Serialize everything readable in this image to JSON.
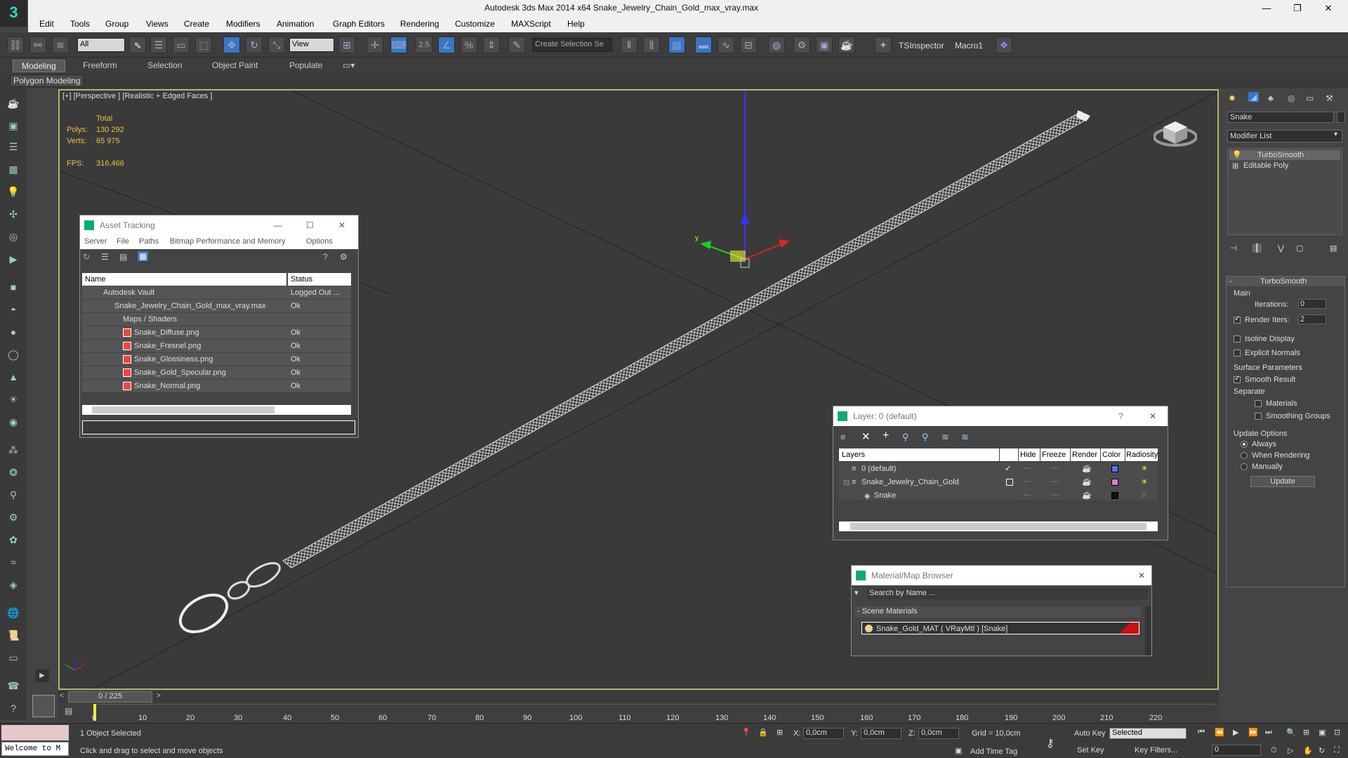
{
  "window": {
    "title": "Autodesk 3ds Max  2014 x64     Snake_Jewelry_Chain_Gold_max_vray.max",
    "minimize": "—",
    "restore": "❐",
    "close": "✕"
  },
  "menu": [
    "Edit",
    "Tools",
    "Group",
    "Views",
    "Create",
    "Modifiers",
    "Animation",
    "Graph Editors",
    "Rendering",
    "Customize",
    "MAXScript",
    "Help"
  ],
  "toolbar": {
    "selection_filter": "All",
    "ref_coord": "View",
    "snap_label": "2.5",
    "named_selection_placeholder": "Create Selection Se",
    "tsinspector": "TSInspector",
    "macro1": "Macro1"
  },
  "ribbon": {
    "tabs": [
      "Modeling",
      "Freeform",
      "Selection",
      "Object Paint",
      "Populate"
    ],
    "sub": "Polygon Modeling"
  },
  "viewport": {
    "label": "[+] [Perspective ] [Realistic + Edged Faces ]",
    "stats": {
      "total": "Total",
      "polys_label": "Polys:",
      "polys": "130 292",
      "verts_label": "Verts:",
      "verts": "65 975",
      "fps_label": "FPS:",
      "fps": "316,466"
    },
    "gizmo": {
      "x": "x",
      "y": "y",
      "z": "z"
    }
  },
  "asset_tracking": {
    "title": "Asset Tracking",
    "menu": [
      "Server",
      "File",
      "Paths",
      "Bitmap Performance and Memory",
      "Options"
    ],
    "columns": [
      "Name",
      "Status"
    ],
    "rows": [
      {
        "name": "Autodesk Vault",
        "status": "Logged Out ..."
      },
      {
        "name": "Snake_Jewelry_Chain_Gold_max_vray.max",
        "status": "Ok"
      },
      {
        "name": "Maps / Shaders",
        "status": ""
      },
      {
        "name": "Snake_Diffuse.png",
        "status": "Ok"
      },
      {
        "name": "Snake_Fresnel.png",
        "status": "Ok"
      },
      {
        "name": "Snake_Glossiness.png",
        "status": "Ok"
      },
      {
        "name": "Snake_Gold_Specular.png",
        "status": "Ok"
      },
      {
        "name": "Snake_Normal.png",
        "status": "Ok"
      }
    ]
  },
  "layer_window": {
    "title": "Layer: 0 (default)",
    "help": "?",
    "columns": [
      "Layers",
      "Hide",
      "Freeze",
      "Render",
      "Color",
      "Radiosity"
    ],
    "rows": [
      {
        "name": "0 (default)",
        "color": "#5577ff"
      },
      {
        "name": "Snake_Jewelry_Chain_Gold",
        "color": "#e07bd8"
      },
      {
        "name": "Snake",
        "color": "#111111"
      }
    ]
  },
  "material_browser": {
    "title": "Material/Map Browser",
    "search_placeholder": "Search by Name ...",
    "section": "- Scene Materials",
    "material": "Snake_Gold_MAT ( VRayMtl ) [Snake]"
  },
  "command_panel": {
    "object_name": "Snake",
    "modifier_list": "Modifier List",
    "stack": [
      "TurboSmooth",
      "Editable Poly"
    ],
    "rollout_title": "TurboSmooth",
    "main": "Main",
    "iterations_label": "Iterations:",
    "iterations": "0",
    "render_iters_label": "Render Iters:",
    "render_iters": "2",
    "isoline": "Isoline Display",
    "explicit_normals": "Explicit Normals",
    "surface_params": "Surface Parameters",
    "smooth_result": "Smooth Result",
    "separate": "Separate",
    "materials": "Materials",
    "smoothing_groups": "Smoothing Groups",
    "update_options": "Update Options",
    "always": "Always",
    "when_rendering": "When Rendering",
    "manually": "Manually",
    "update": "Update"
  },
  "timeline": {
    "frame": "0 / 225",
    "ticks": [
      "0",
      "10",
      "20",
      "30",
      "40",
      "50",
      "60",
      "70",
      "80",
      "90",
      "100",
      "110",
      "120",
      "130",
      "140",
      "150",
      "160",
      "170",
      "180",
      "190",
      "200",
      "210",
      "220"
    ]
  },
  "status": {
    "maxscript": "Welcome to M",
    "selected": "1 Object Selected",
    "prompt": "Click and drag to select and move objects",
    "x_label": "X:",
    "x": "0,0cm",
    "y_label": "Y:",
    "y": "0,0cm",
    "z_label": "Z:",
    "z": "0,0cm",
    "grid": "Grid = 10,0cm",
    "add_time_tag": "Add Time Tag",
    "auto_key": "Auto Key",
    "selected_dropdown": "Selected",
    "set_key": "Set Key",
    "key_filters": "Key Filters...",
    "frame_field": "0"
  },
  "colors": {
    "accent": "#b8b36a",
    "stat_text": "#e8c341"
  }
}
